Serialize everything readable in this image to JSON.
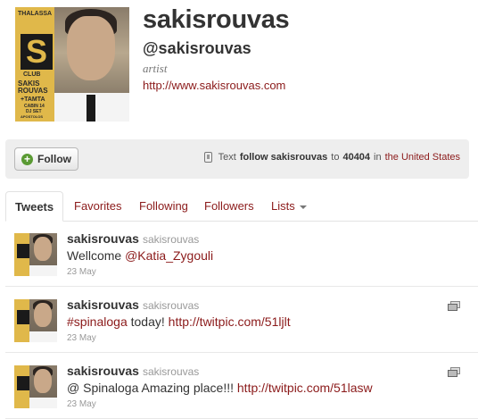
{
  "profile": {
    "name": "sakisrouvas",
    "handle": "@sakisrouvas",
    "bio": "artist",
    "url": "http://www.sakisrouvas.com",
    "poster": {
      "top": "THALASSA",
      "club": "CLUB",
      "artist": "SAKIS ROUVAS",
      "guest": "+TAMTA",
      "night": "CABIN 14",
      "dj1": "DJ SET",
      "dj2": "APOSTOLOS",
      "dj3": "MITROPOULOS"
    }
  },
  "action_bar": {
    "follow_label": "Follow",
    "sms": {
      "prefix": "Text",
      "command": "follow sakisrouvas",
      "to": "to",
      "number": "40404",
      "in": "in",
      "country": "the United States"
    }
  },
  "tabs": [
    {
      "label": "Tweets",
      "active": true
    },
    {
      "label": "Favorites",
      "active": false
    },
    {
      "label": "Following",
      "active": false
    },
    {
      "label": "Followers",
      "active": false
    },
    {
      "label": "Lists",
      "active": false
    }
  ],
  "tweets": [
    {
      "name": "sakisrouvas",
      "handle": "sakisrouvas",
      "text_plain": "Wellcome ",
      "text_link": "@Katia_Zygouli",
      "text_tail": "",
      "time": "23 May",
      "has_media": false
    },
    {
      "name": "sakisrouvas",
      "handle": "sakisrouvas",
      "hashtag": "#spinaloga",
      "text_plain": " today! ",
      "text_link": "http://twitpic.com/51ljlt",
      "time": "23 May",
      "has_media": true
    },
    {
      "name": "sakisrouvas",
      "handle": "sakisrouvas",
      "text_plain": "@ Spinaloga Amazing place!!! ",
      "text_link": "http://twitpic.com/51lasw",
      "time": "23 May",
      "has_media": true
    }
  ],
  "colors": {
    "link": "#8b1a1a",
    "action_bar_bg": "#eeeeee",
    "follow_plus": "#5a9a33"
  }
}
